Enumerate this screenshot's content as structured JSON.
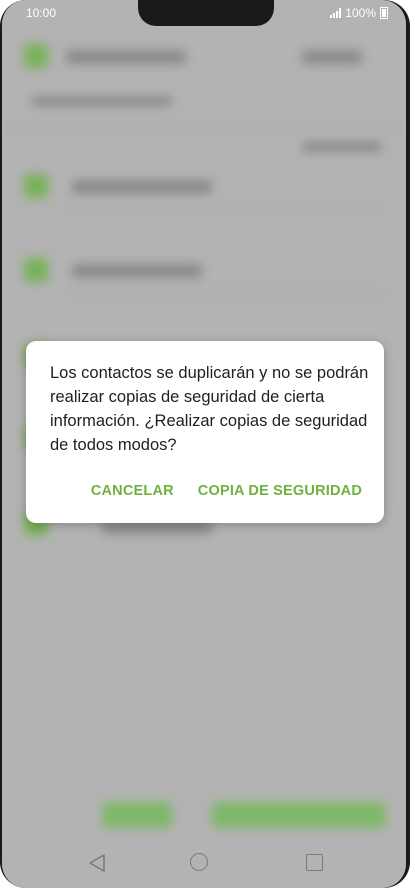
{
  "status_bar": {
    "time": "10:00",
    "battery": "100%",
    "icons": [
      "signal-icon",
      "battery-icon"
    ]
  },
  "dialog": {
    "message": "Los contactos se duplicarán y no se podrán realizar copias de seguridad de cierta información. ¿Realizar copias de seguridad de todos modos?",
    "cancel_label": "CANCELAR",
    "confirm_label": "COPIA DE SEGURIDAD"
  },
  "nav_bar": {
    "icons": [
      "back-icon",
      "home-icon",
      "recent-apps-icon"
    ]
  },
  "colors": {
    "accent": "#6fb03f",
    "scrim": "#b3b3b3",
    "text": "#212121"
  }
}
